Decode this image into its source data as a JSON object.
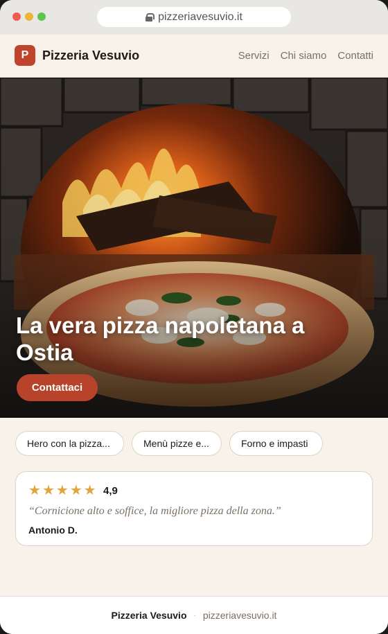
{
  "browser": {
    "url": "pizzeriavesuvio.it"
  },
  "header": {
    "logo_letter": "P",
    "brand": "Pizzeria Vesuvio",
    "nav": [
      "Servizi",
      "Chi siamo",
      "Contatti"
    ]
  },
  "hero": {
    "title": "La vera pizza napoletana a Ostia",
    "cta_label": "Contattaci"
  },
  "chips": [
    "Hero con la pizza...",
    "Menù pizze e...",
    "Forno e impasti"
  ],
  "review": {
    "stars": 5,
    "rating": "4,9",
    "quote": "“Cornicione alto e soffice, la migliore pizza della zona.”",
    "author": "Antonio D."
  },
  "footer": {
    "brand": "Pizzeria Vesuvio",
    "separator": "·",
    "url": "pizzeriavesuvio.it"
  },
  "colors": {
    "accent": "#b8432b",
    "star": "#e0a53b",
    "background": "#f7f2ea"
  }
}
